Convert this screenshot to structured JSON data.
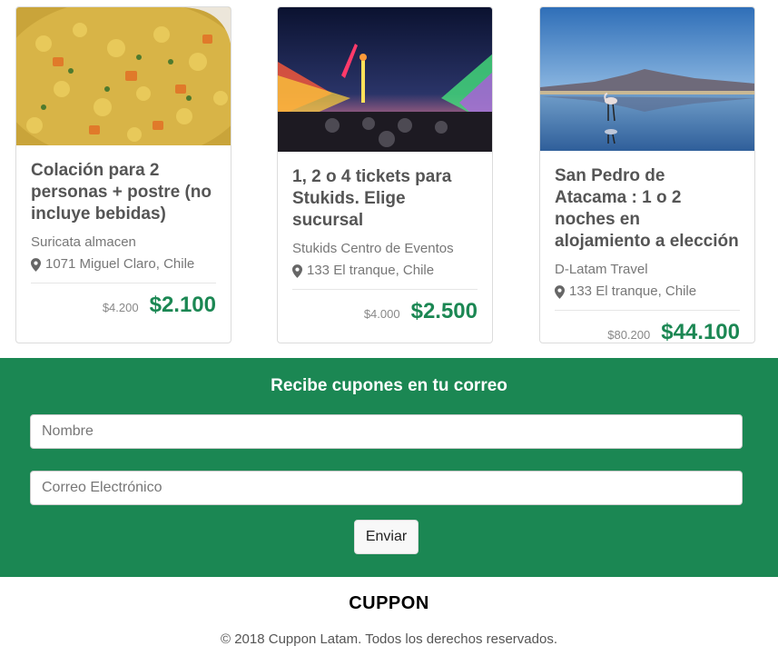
{
  "deals": [
    {
      "title": "Colación para 2 personas + postre (no incluye bebidas)",
      "merchant": "Suricata almacen",
      "location": "1071 Miguel Claro, Chile",
      "old_price": "$4.200",
      "new_price": "$2.100",
      "image_subject": "lentil stew"
    },
    {
      "title": "1, 2 o 4 tickets para Stukids. Elige sucursal",
      "merchant": "Stukids Centro de Eventos",
      "location": "133 El tranque, Chile",
      "old_price": "$4.000",
      "new_price": "$2.500",
      "image_subject": "amusement park at night"
    },
    {
      "title": "San Pedro de Atacama : 1 o 2 noches en alojamiento a elección",
      "merchant": "D-Latam Travel",
      "location": "133 El tranque, Chile",
      "old_price": "$80.200",
      "new_price": "$44.100",
      "image_subject": "flamingo in salt lagoon"
    }
  ],
  "newsletter": {
    "title": "Recibe cupones en tu correo",
    "name_placeholder": "Nombre",
    "email_placeholder": "Correo Electrónico",
    "submit_label": "Enviar"
  },
  "footer": {
    "brand": "CUPPON",
    "copyright": "© 2018 Cuppon Latam. Todos los derechos reservados."
  },
  "colors": {
    "accent": "#1b8753",
    "icon": "pin-icon"
  }
}
